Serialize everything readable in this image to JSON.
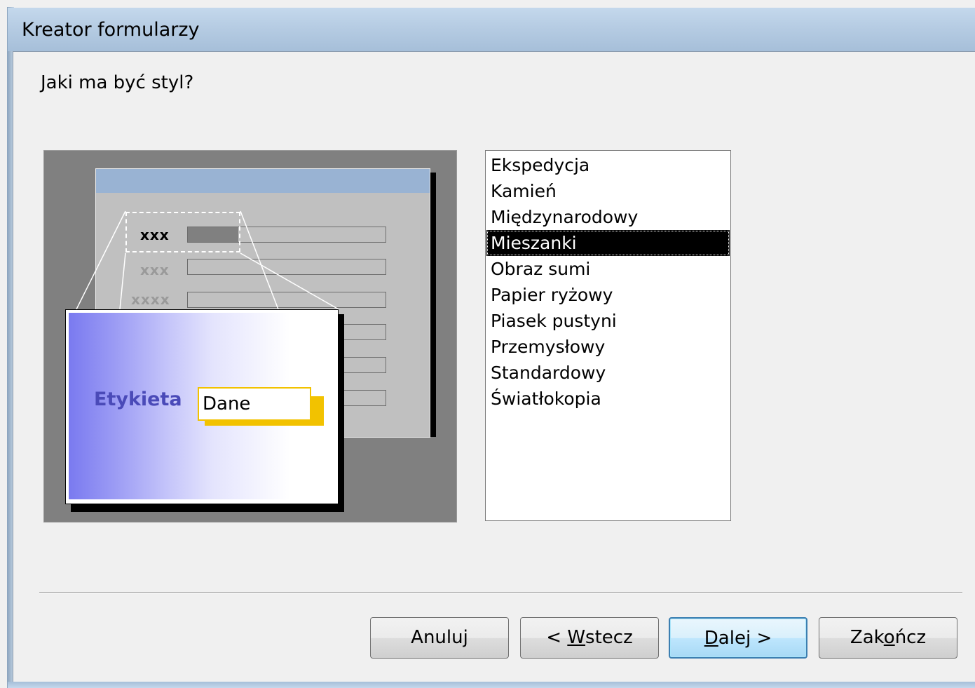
{
  "window": {
    "title": "Kreator formularzy"
  },
  "question": "Jaki ma być styl?",
  "preview": {
    "labels": [
      "xxx",
      "xxx",
      "xxxx"
    ],
    "sample_label": "Etykieta",
    "sample_data": "Dane"
  },
  "styles": {
    "items": [
      "Ekspedycja",
      "Kamień",
      "Międzynarodowy",
      "Mieszanki",
      "Obraz sumi",
      "Papier ryżowy",
      "Piasek pustyni",
      "Przemysłowy",
      "Standardowy",
      "Światłokopia"
    ],
    "selected": "Mieszanki"
  },
  "buttons": {
    "cancel": "Anuluj",
    "back_prefix": "< ",
    "back_mnemonic": "W",
    "back_rest": "stecz",
    "next_mnemonic": "D",
    "next_rest": "alej >",
    "finish_pre": "Zak",
    "finish_mnemonic": "o",
    "finish_rest": "ńcz"
  },
  "colors": {
    "selection_bg": "#000000",
    "title_bar": "#b6cce3",
    "card_label": "#4a4ab8",
    "data_border": "#f2c200"
  }
}
